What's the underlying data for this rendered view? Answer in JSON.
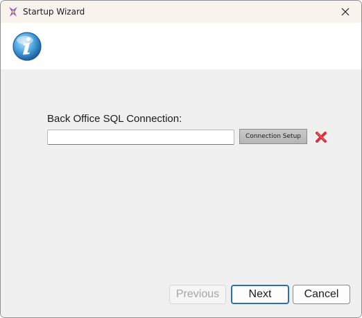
{
  "window": {
    "title": "Startup Wizard",
    "app_icon": "wizard-icon",
    "close_icon": "close-icon"
  },
  "header": {
    "icon": "info-icon"
  },
  "form": {
    "connection_label": "Back Office SQL Connection:",
    "connection_value": "",
    "setup_button_label": "Connection Setup",
    "clear_icon": "red-x-icon"
  },
  "footer": {
    "previous_label": "Previous",
    "next_label": "Next",
    "cancel_label": "Cancel",
    "previous_enabled": false
  },
  "colors": {
    "accent": "#2c6fb0",
    "clear_red": "#d9303a",
    "info_blue": "#2f86c8"
  }
}
